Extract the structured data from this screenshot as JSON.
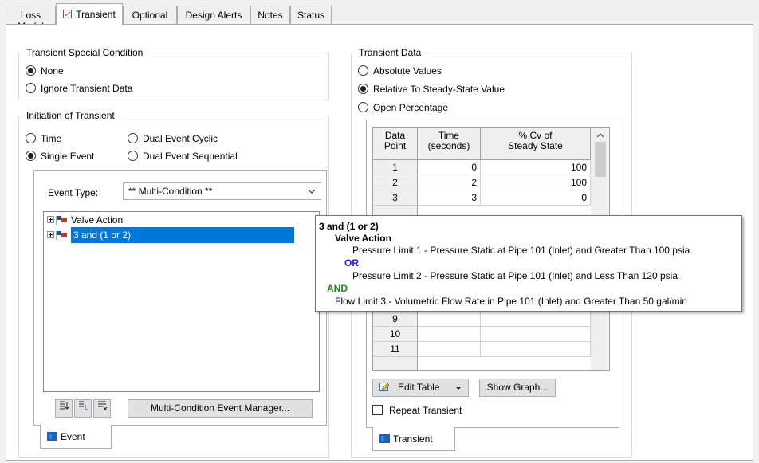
{
  "tabs": [
    {
      "label": "Loss Model",
      "active": false
    },
    {
      "label": "Transient",
      "active": true
    },
    {
      "label": "Optional",
      "active": false
    },
    {
      "label": "Design Alerts",
      "active": false
    },
    {
      "label": "Notes",
      "active": false
    },
    {
      "label": "Status",
      "active": false
    }
  ],
  "special_condition": {
    "title": "Transient Special Condition",
    "options": [
      "None",
      "Ignore Transient Data"
    ],
    "selected": "None"
  },
  "initiation": {
    "title": "Initiation of Transient",
    "options": [
      "Time",
      "Dual Event Cyclic",
      "Single Event",
      "Dual Event Sequential"
    ],
    "selected": "Single Event"
  },
  "event_panel": {
    "event_type_label": "Event Type:",
    "event_type_value": "** Multi-Condition **",
    "tree_items": [
      "Valve Action",
      "3 and (1 or 2)"
    ],
    "selected_item": "3 and (1 or 2)",
    "manager_button": "Multi-Condition Event Manager...",
    "tab_label": "Event"
  },
  "transient_data": {
    "title": "Transient Data",
    "options": [
      "Absolute Values",
      "Relative To Steady-State Value",
      "Open Percentage"
    ],
    "selected": "Relative To Steady-State Value",
    "table": {
      "headers": [
        [
          "Data",
          "Point"
        ],
        [
          "Time",
          "(seconds)"
        ],
        [
          "% Cv of",
          "Steady State"
        ]
      ],
      "rows": [
        [
          "1",
          "0",
          "100"
        ],
        [
          "2",
          "2",
          "100"
        ],
        [
          "3",
          "3",
          "0"
        ],
        [
          "9",
          "",
          ""
        ],
        [
          "10",
          "",
          ""
        ],
        [
          "11",
          "",
          ""
        ]
      ]
    },
    "edit_table_button": "Edit Table",
    "show_graph_button": "Show Graph...",
    "repeat_label": "Repeat Transient",
    "tab_label": "Transient"
  },
  "tooltip": {
    "title": "3 and (1 or 2)",
    "group": "Valve Action",
    "line1": "Pressure Limit 1 - Pressure Static at Pipe 101 (Inlet) and Greater Than 100 psia",
    "or_label": "OR",
    "line2": "Pressure Limit 2 - Pressure Static at Pipe 101 (Inlet) and Less Than 120 psia",
    "and_label": "AND",
    "line3": "Flow Limit 3 - Volumetric Flow Rate in Pipe 101 (Inlet) and Greater Than 50 gal/min"
  },
  "colors": {
    "selection": "#0078d7",
    "or": "#1a1ad6",
    "and": "#1a8a1a"
  }
}
